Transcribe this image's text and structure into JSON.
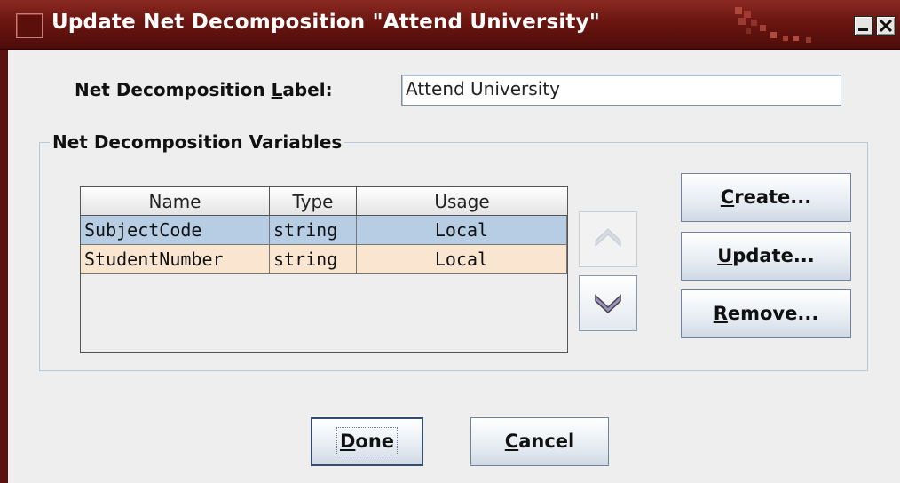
{
  "window": {
    "title": "Update Net Decomposition  \"Attend University\"",
    "colors": {
      "titlebar": "#6a1510",
      "frame": "#5a100c",
      "selection": "#b7cde4",
      "alt_row": "#fae5d0"
    }
  },
  "form": {
    "label_prefix": "Net Decomposition ",
    "label_mnemonic": "L",
    "label_suffix": "abel:",
    "label_value": "Attend University"
  },
  "variables": {
    "group_title": "Net Decomposition Variables",
    "columns": [
      "Name",
      "Type",
      "Usage"
    ],
    "rows": [
      {
        "name": "SubjectCode",
        "type": "string",
        "usage": "Local"
      },
      {
        "name": "StudentNumber",
        "type": "string",
        "usage": "Local"
      }
    ],
    "buttons": {
      "create": {
        "mnemonic": "C",
        "rest": "reate..."
      },
      "update": {
        "mnemonic": "U",
        "rest": "pdate..."
      },
      "remove": {
        "mnemonic": "R",
        "rest": "emove..."
      }
    },
    "icons": {
      "move_up": "chevron-up-icon",
      "move_down": "chevron-down-icon"
    }
  },
  "footer": {
    "done": {
      "mnemonic": "D",
      "rest": "one"
    },
    "cancel": {
      "mnemonic": "C",
      "rest": "ancel"
    }
  }
}
